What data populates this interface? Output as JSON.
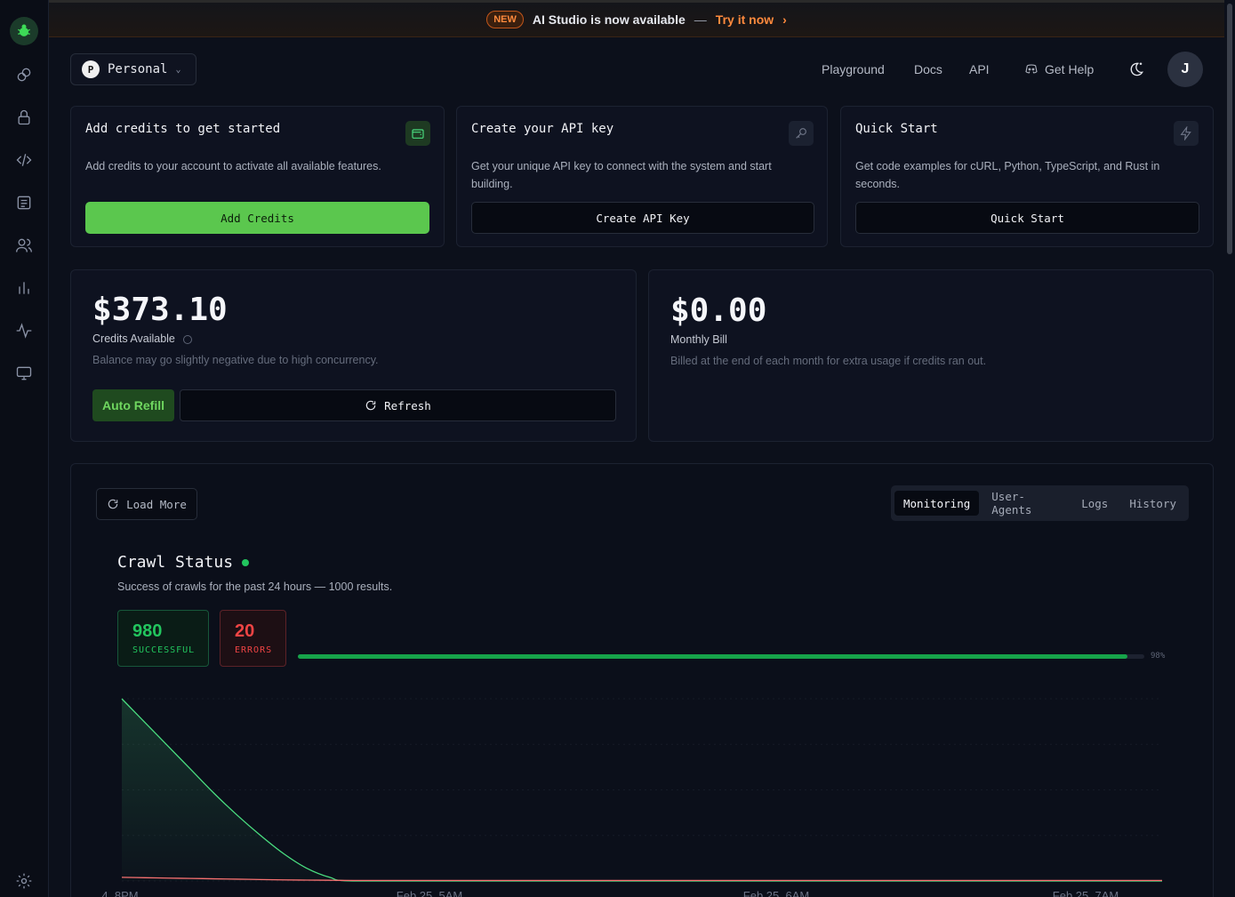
{
  "banner": {
    "badge": "NEW",
    "message": "AI Studio is now available",
    "separator": "—",
    "cta": "Try it now",
    "chevron": "›"
  },
  "header": {
    "workspace_initial": "P",
    "workspace_name": "Personal",
    "nav": [
      "Playground",
      "Docs",
      "API"
    ],
    "help_label": "Get Help",
    "user_initial": "J"
  },
  "cards": [
    {
      "title": "Add credits to get started",
      "description": "Add credits to your account to activate all available features.",
      "button": "Add Credits",
      "icon": "wallet-icon"
    },
    {
      "title": "Create your API key",
      "description": "Get your unique API key to connect with the system and start building.",
      "button": "Create API Key",
      "icon": "key-icon"
    },
    {
      "title": "Quick Start",
      "description": "Get code examples for cURL, Python, TypeScript, and Rust in seconds.",
      "button": "Quick Start",
      "icon": "lightning-icon"
    }
  ],
  "credits": {
    "amount": "$373.10",
    "label": "Credits Available",
    "note": "Balance may go slightly negative due to high concurrency.",
    "auto_refill": "Auto Refill",
    "refresh": "Refresh"
  },
  "bill": {
    "amount": "$0.00",
    "label": "Monthly Bill",
    "note": "Billed at the end of each month for extra usage if credits ran out."
  },
  "monitoring": {
    "load_more": "Load More",
    "tabs": [
      "Monitoring",
      "User-Agents",
      "Logs",
      "History"
    ],
    "active_tab": "Monitoring",
    "title": "Crawl Status",
    "description": "Success of crawls for the past 24 hours — 1000 results.",
    "successful_count": "980",
    "successful_label": "SUCCESSFUL",
    "error_count": "20",
    "error_label": "ERRORS",
    "success_ratio": 0.98,
    "success_pct": "98%"
  },
  "chart_data": {
    "type": "area",
    "x_ticks": [
      "4, 8PM",
      "Feb 25, 5AM",
      "Feb 25, 6AM",
      "Feb 25, 7AM"
    ],
    "x": [
      0,
      0.1,
      0.2,
      0.3,
      0.4,
      0.5,
      0.6,
      0.7,
      0.8,
      0.9,
      1.0,
      1.5,
      2.0,
      2.5,
      3.0,
      3.5,
      4.0,
      4.5
    ],
    "series": [
      {
        "color": "#4ade80",
        "values": [
          100,
          87,
          74,
          61,
          48,
          36,
          25,
          15,
          7,
          2,
          0,
          0,
          0,
          0,
          0,
          0,
          0,
          0
        ]
      },
      {
        "color": "#f87171",
        "values": [
          2,
          1.8,
          1.6,
          1.4,
          1.2,
          1.0,
          0.8,
          0.6,
          0.5,
          0.4,
          0.3,
          0.3,
          0.3,
          0.3,
          0.3,
          0.3,
          0.3,
          0.3
        ]
      }
    ],
    "grid": true
  }
}
